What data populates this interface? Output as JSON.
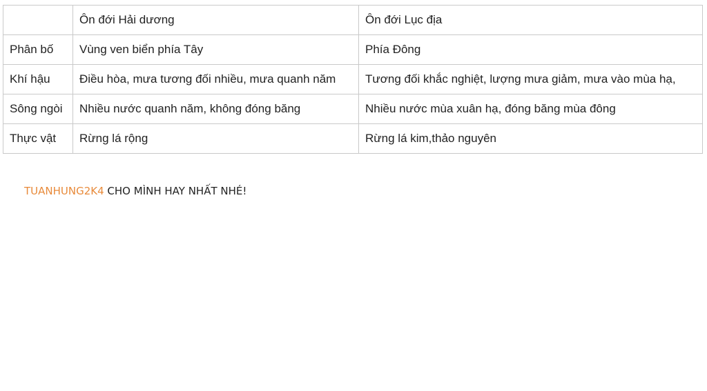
{
  "table": {
    "header": [
      "",
      "Ôn đới Hải dương",
      "Ôn đới Lục địa"
    ],
    "rows": [
      [
        "Phân bố",
        "Vùng ven biển phía Tây",
        "Phía Đông"
      ],
      [
        "Khí hậu",
        "Điều hòa, mưa tương đối nhiều, mưa quanh năm",
        "Tương đối khắc nghiệt, lượng mưa giảm, mưa vào mùa hạ,"
      ],
      [
        "Sông ngòi",
        "Nhiều nước quanh năm, không đóng băng",
        "Nhiều nước mùa xuân hạ, đóng băng mùa đông"
      ],
      [
        "Thực vật",
        "Rừng lá rộng",
        "Rừng lá kim,thảo nguyên"
      ]
    ]
  },
  "note": {
    "user": "TUANHUNG2K4",
    "message": " CHO MÌNH HAY NHẤT NHÉ!"
  },
  "colors": {
    "user": "#e88a3a",
    "border": "#c9c9c9",
    "text": "#222222"
  }
}
